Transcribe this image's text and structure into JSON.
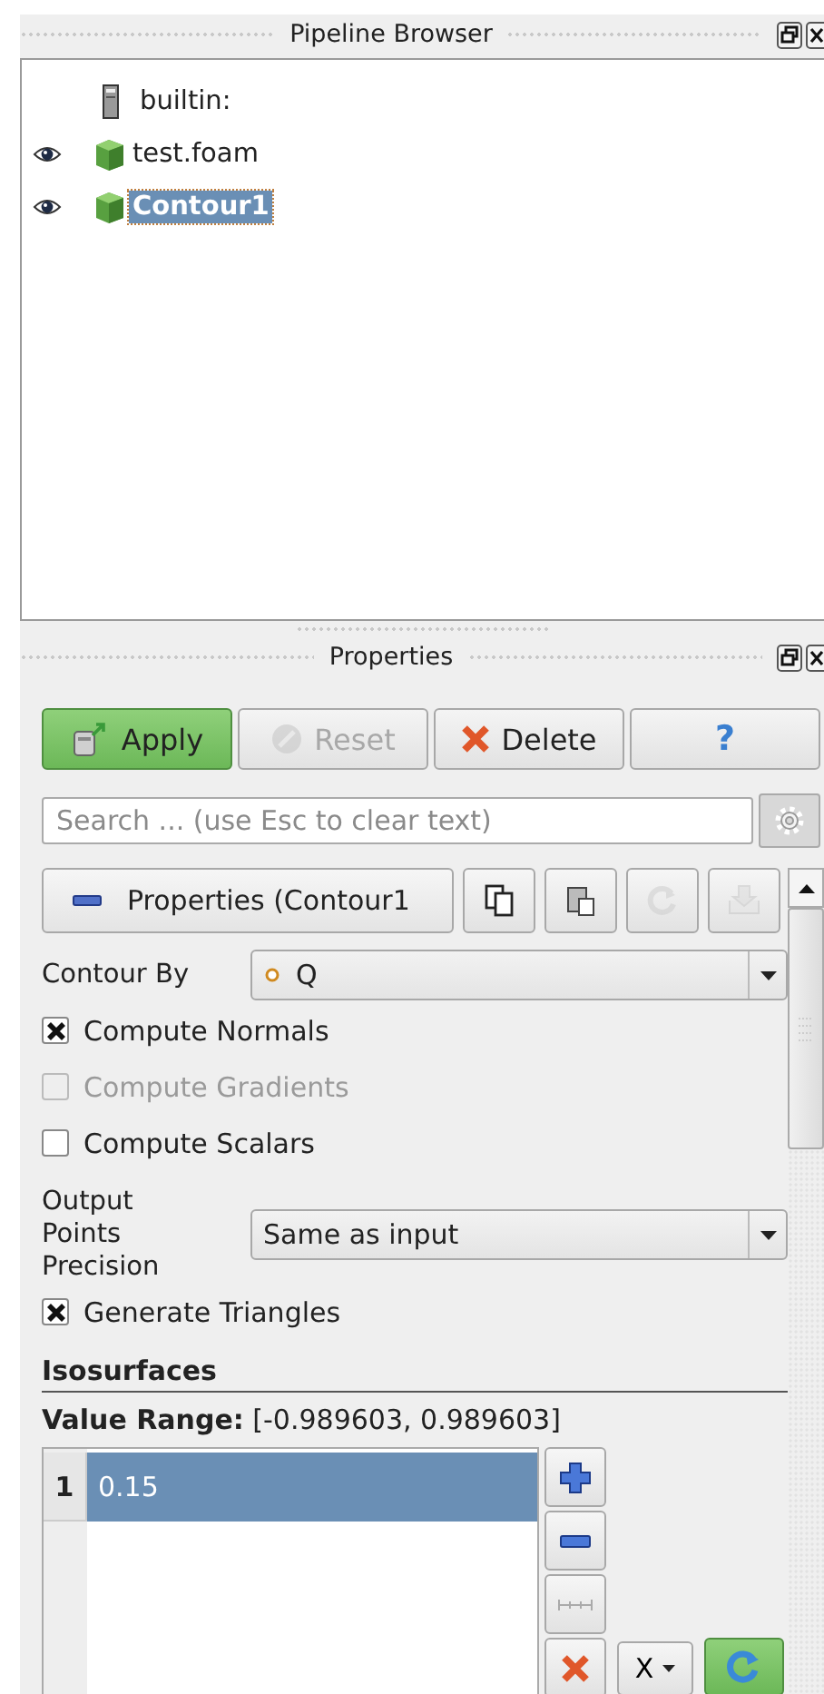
{
  "pipeline_browser": {
    "title": "Pipeline Browser",
    "items": [
      {
        "label": "builtin:",
        "kind": "server",
        "visible": false,
        "selected": false
      },
      {
        "label": "test.foam",
        "kind": "source",
        "visible": true,
        "selected": false
      },
      {
        "label": "Contour1",
        "kind": "source",
        "visible": true,
        "selected": true
      }
    ]
  },
  "properties": {
    "title": "Properties",
    "buttons": [
      {
        "label": "Apply",
        "kind": "apply",
        "disabled": false
      },
      {
        "label": "Reset",
        "kind": "reset",
        "disabled": true
      },
      {
        "label": "Delete",
        "kind": "delete",
        "disabled": false
      },
      {
        "label": "?",
        "kind": "help",
        "disabled": false
      }
    ],
    "search": {
      "placeholder": "Search ... (use Esc to clear text)"
    },
    "section_button": {
      "label": "Properties (Contour1"
    },
    "tool_buttons": [
      {
        "kind": "copy",
        "disabled": false
      },
      {
        "kind": "paste",
        "disabled": false
      },
      {
        "kind": "reload",
        "disabled": true
      },
      {
        "kind": "save",
        "disabled": true
      }
    ],
    "fields": [
      {
        "kind": "combo",
        "label": "Contour By",
        "value": "Q",
        "point_data": true
      },
      {
        "kind": "checkbox",
        "label": "Compute Normals",
        "checked": true,
        "disabled": false
      },
      {
        "kind": "checkbox",
        "label": "Compute Gradients",
        "checked": false,
        "disabled": true
      },
      {
        "kind": "checkbox",
        "label": "Compute Scalars",
        "checked": false,
        "disabled": false
      },
      {
        "kind": "combo",
        "label": "Output Points Precision",
        "value": "Same as input",
        "point_data": false
      },
      {
        "kind": "checkbox",
        "label": "Generate Triangles",
        "checked": true,
        "disabled": false
      }
    ],
    "isosurfaces": {
      "title": "Isosurfaces",
      "value_range": "**Value Range:** [-0.989603, 0.989603]",
      "rows": [
        {
          "index": "1",
          "value": "0.15",
          "selected": true
        }
      ],
      "axis_dropdown": "X"
    }
  }
}
